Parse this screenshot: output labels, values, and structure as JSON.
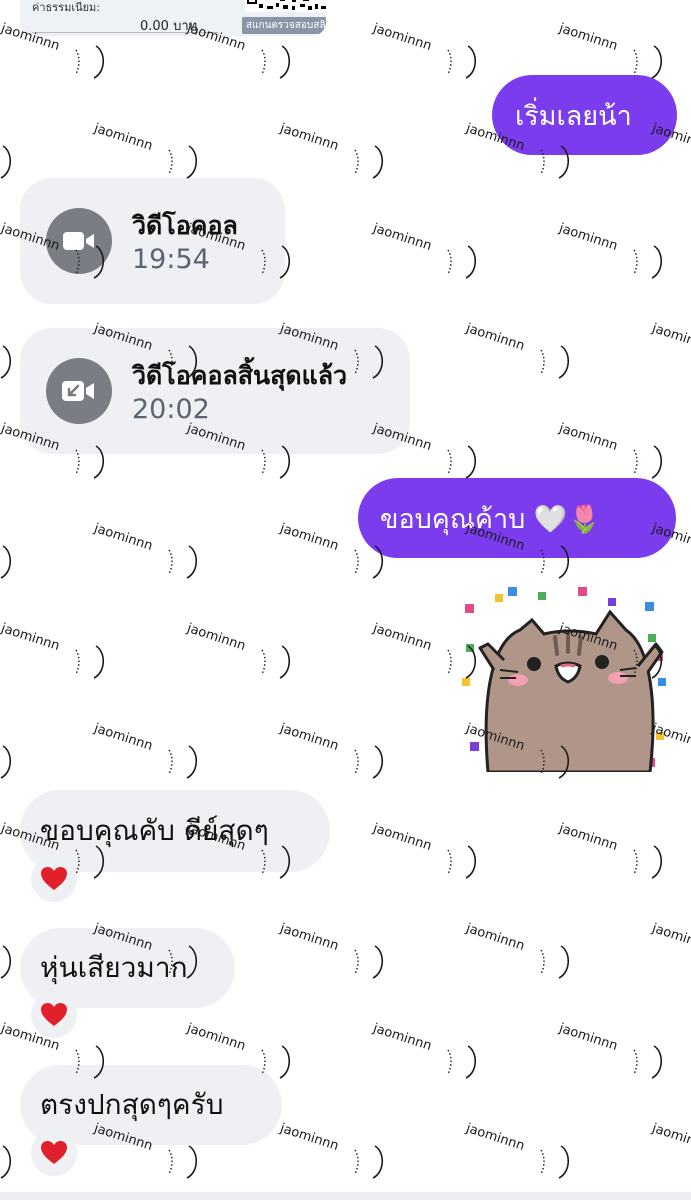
{
  "receipt": {
    "fee_label": "ค่าธรรมเนียม:",
    "fee_amount": "0.00 บาท",
    "qr_caption": "สแกนตรวจสอบสลิป"
  },
  "messages": {
    "sent_1": "เริ่มเลยน้า",
    "video_call": {
      "title": "วิดีโอคอล",
      "time": "19:54",
      "icon": "video-camera-icon"
    },
    "call_ended": {
      "title": "วิดีโอคอลสิ้นสุดแล้ว",
      "time": "20:02",
      "icon": "video-call-ended-icon"
    },
    "sent_2": "ขอบคุณค้าบ 🤍🌷",
    "sticker": "cat-celebration-sticker",
    "received_1": {
      "text": "ขอบคุณคับ ดีย์สุดๆ",
      "reaction": "❤️"
    },
    "received_2": {
      "text": "หุ่นเสียวมาก",
      "reaction": "❤️"
    },
    "received_3": {
      "text": "ตรงปกสุดๆครับ",
      "reaction": "❤️"
    }
  },
  "watermark": {
    "text": "jaominnn"
  },
  "colors": {
    "outgoing_bubble": "#7b3cee",
    "incoming_bubble": "#eef0f3",
    "call_icon_bg": "#7a7d83",
    "heart": "#e0202a"
  }
}
